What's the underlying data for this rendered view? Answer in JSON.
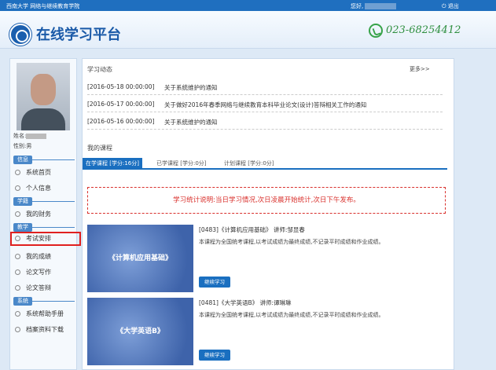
{
  "topbar": {
    "school": "西南大学 网络与继续教育学院",
    "welcome": "您好,",
    "logout": "退出"
  },
  "header": {
    "title": "在线学习平台",
    "phone": "023-68254412"
  },
  "sidebar": {
    "name_label": "姓名:",
    "gender": "性别:男",
    "sections": [
      {
        "label": "信息",
        "items": [
          "系统首页",
          "个人信息"
        ]
      },
      {
        "label": "学籍",
        "items": [
          "我的财务"
        ]
      },
      {
        "label": "教学",
        "items": [
          "考试安排",
          "我的成绩",
          "论文写作",
          "论文答辩"
        ]
      },
      {
        "label": "系统",
        "items": [
          "系统帮助手册",
          "档案资料下载"
        ]
      }
    ]
  },
  "news": {
    "title": "学习动态",
    "more": "更多>>",
    "items": [
      {
        "date": "[2016-05-18 00:00:00]",
        "text": "关于系统维护的通知"
      },
      {
        "date": "[2016-05-17 00:00:00]",
        "text": "关于做好2016年春季网络与继续教育本科毕业论文(设计)答辩相关工作的通知"
      },
      {
        "date": "[2016-05-16 00:00:00]",
        "text": "关于系统维护的通知"
      }
    ]
  },
  "courses": {
    "title": "我的课程",
    "tabs": [
      "在学课程 [学分:16分]",
      "已学课程 [学分:0分]",
      "计划课程 [学分:0分]"
    ],
    "notice": "学习统计说明:当日学习情况,次日凌晨开始统计,次日下午发布。",
    "items": [
      {
        "cover": "《计算机应用基础》",
        "title": "[0483]《计算机应用基础》 讲师:邹显春",
        "desc": "本课程为全国统考课程,以考试成绩为最终成绩,不记录平时成绩和作业成绩。",
        "button": "继续学习"
      },
      {
        "cover": "《大学英语B》",
        "title": "[0481]《大学英语B》 讲师:谭琳琳",
        "desc": "本课程为全国统考课程,以考试成绩为最终成绩,不记录平时成绩和作业成绩。",
        "button": "继续学习"
      }
    ]
  },
  "colors": {
    "brand_blue": "#1a6fc0",
    "notice_red": "#d9302c",
    "highlight_red": "#e0201f"
  }
}
